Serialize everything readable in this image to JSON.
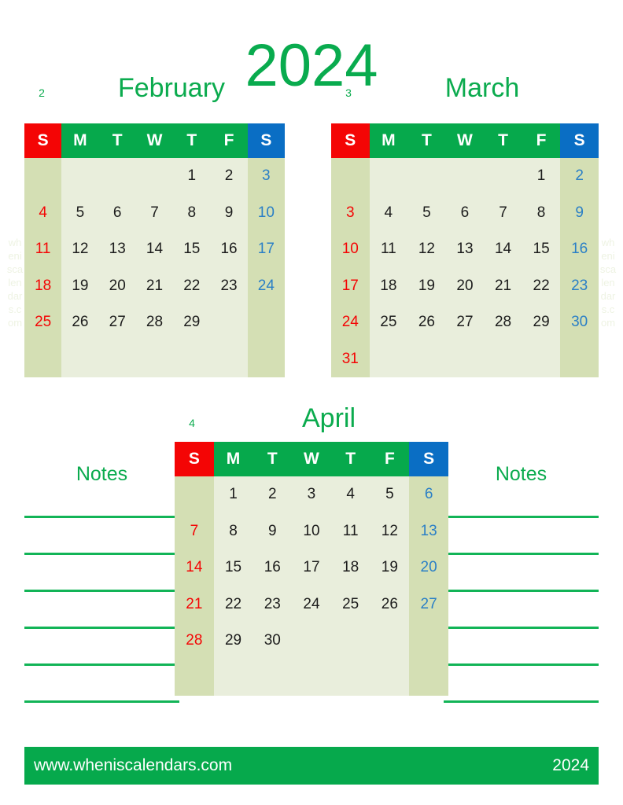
{
  "page": {
    "year_title": "2024",
    "watermark_text": "wheniscalendars.com"
  },
  "colors": {
    "green": "#06a94c",
    "bright_green": "#0bab4e",
    "sunday_red": "#f40505",
    "saturday_blue": "#0a6ec4",
    "weekend_cell": "#d4dfb4",
    "weekday_cell": "#e9eedc",
    "line_green": "#12b457"
  },
  "weekday_headers": [
    "S",
    "M",
    "T",
    "W",
    "T",
    "F",
    "S"
  ],
  "months": [
    {
      "number": "2",
      "name": "February",
      "weeks": [
        [
          "",
          "",
          "",
          "",
          "1",
          "2",
          "3"
        ],
        [
          "4",
          "5",
          "6",
          "7",
          "8",
          "9",
          "10"
        ],
        [
          "11",
          "12",
          "13",
          "14",
          "15",
          "16",
          "17"
        ],
        [
          "18",
          "19",
          "20",
          "21",
          "22",
          "23",
          "24"
        ],
        [
          "25",
          "26",
          "27",
          "28",
          "29",
          "",
          ""
        ],
        [
          "",
          "",
          "",
          "",
          "",
          "",
          ""
        ]
      ]
    },
    {
      "number": "3",
      "name": "March",
      "weeks": [
        [
          "",
          "",
          "",
          "",
          "",
          "1",
          "2"
        ],
        [
          "3",
          "4",
          "5",
          "6",
          "7",
          "8",
          "9"
        ],
        [
          "10",
          "11",
          "12",
          "13",
          "14",
          "15",
          "16"
        ],
        [
          "17",
          "18",
          "19",
          "20",
          "21",
          "22",
          "23"
        ],
        [
          "24",
          "25",
          "26",
          "27",
          "28",
          "29",
          "30"
        ],
        [
          "31",
          "",
          "",
          "",
          "",
          "",
          ""
        ]
      ]
    },
    {
      "number": "4",
      "name": "April",
      "weeks": [
        [
          "",
          "1",
          "2",
          "3",
          "4",
          "5",
          "6"
        ],
        [
          "7",
          "8",
          "9",
          "10",
          "11",
          "12",
          "13"
        ],
        [
          "14",
          "15",
          "16",
          "17",
          "18",
          "19",
          "20"
        ],
        [
          "21",
          "22",
          "23",
          "24",
          "25",
          "26",
          "27"
        ],
        [
          "28",
          "29",
          "30",
          "",
          "",
          "",
          ""
        ],
        [
          "",
          "",
          "",
          "",
          "",
          "",
          ""
        ]
      ]
    }
  ],
  "notes": {
    "left_title": "Notes",
    "right_title": "Notes",
    "line_count": 6
  },
  "footer": {
    "url": "www.wheniscalendars.com",
    "year": "2024"
  }
}
